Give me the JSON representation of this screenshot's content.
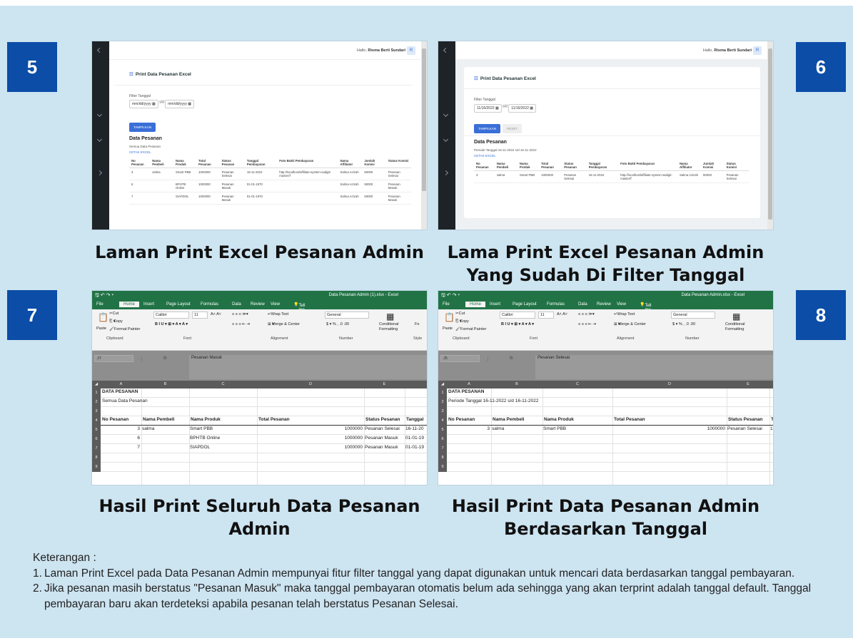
{
  "badges": [
    "5",
    "6",
    "7",
    "8"
  ],
  "captions": {
    "c5": "Laman Print Excel Pesanan Admin",
    "c6a": "Lama Print Excel Pesanan Admin",
    "c6b": "Yang Sudah Di Filter Tanggal",
    "c7a": "Hasil Print Seluruh Data Pesanan",
    "c7b": "Admin",
    "c8a": "Hasil Print Data Pesanan Admin",
    "c8b": "Berdasarkan Tanggal"
  },
  "notes": {
    "title": "Keterangan :",
    "items": [
      {
        "num": "1.",
        "text": "Laman Print Excel pada Data Pesanan Admin mempunyai fitur filter tanggal yang dapat digunakan untuk mencari data berdasarkan tanggal pembayaran."
      },
      {
        "num": "2.",
        "text": "Jika pesanan masih berstatus \"Pesanan Masuk\" maka tanggal pembayaran otomatis belum ada sehingga yang akan terprint adalah tanggal default. Tanggal pembayaran baru akan terdeteksi apabila pesanan telah berstatus Pesanan Selesai."
      }
    ]
  },
  "app": {
    "hello_prefix": "Hallo, ",
    "user": "Risma Berti Sundari",
    "avatar": "R",
    "title": "Print Data Pesanan Excel",
    "title_icon": "table-icon",
    "filter_label": "Filter Tanggal",
    "sd": "s/d",
    "btn_show": "TAMPILKAN",
    "btn_reset": "RESET",
    "data_title": "Data Pesanan",
    "export": "CETAK EXCEL",
    "headers": [
      "No Pesanan",
      "Nama Pembeli",
      "Nama Produk",
      "Total Pesanan",
      "Status Pesanan",
      "Tanggal Pembayaran",
      "Foto Bukti Pembayaran",
      "Nama Affiliator",
      "Jumlah Komisi",
      "Status Komisi"
    ]
  },
  "screen5": {
    "date_from": "mm/dd/yyyy",
    "date_to": "mm/dd/yyyy",
    "subtitle": "Semua Data Pesanan",
    "rows": [
      [
        "3",
        "salma",
        "Smart PBB",
        "1000000",
        "Pesanan Selesai",
        "16-11-2022",
        "http://localhost/affiliate-system-sadigit-master/f",
        "Salma Azizah",
        "50000",
        "Pesanan Selesai"
      ],
      [
        "6",
        "",
        "BPHTB Online",
        "1000000",
        "Pesanan Masuk",
        "01-01-1970",
        "",
        "Salma Azizah",
        "50000",
        "Pesanan Masuk"
      ],
      [
        "7",
        "",
        "SIAPDOL",
        "1000000",
        "Pesanan Masuk",
        "01-01-1970",
        "",
        "Salma Azizah",
        "50000",
        "Pesanan Masuk"
      ]
    ]
  },
  "screen6": {
    "date_from": "11/16/2022",
    "date_to": "11/16/2022",
    "subtitle": "Periode Tanggal 16-11-2022 s/d 16-11-2022",
    "rows": [
      [
        "3",
        "salma",
        "Smart PBB",
        "1000000",
        "Pesanan Selesai",
        "16-11-2022",
        "http://localhost/affiliate-system-sadigit-master/f",
        "Salma Azizah",
        "50000",
        "Pesanan Selesai"
      ]
    ]
  },
  "excel": {
    "menu": [
      "File",
      "Home",
      "Insert",
      "Page Layout",
      "Formulas",
      "Data",
      "Review",
      "View"
    ],
    "tell_me": "Tell me what you want to do...",
    "clipboard": {
      "cut": "Cut",
      "copy": "Copy",
      "paste": "Paste",
      "painter": "Format Painter",
      "label": "Clipboard"
    },
    "font": {
      "name": "Calibri",
      "size": "11",
      "label": "Font"
    },
    "alignment": {
      "wrap": "Wrap Text",
      "merge": "Merge & Center",
      "label": "Alignment"
    },
    "number": {
      "format": "General",
      "label": "Number"
    },
    "styles": {
      "conditional": "Conditional Formatting"
    },
    "fx": "fx",
    "cols": [
      "A",
      "B",
      "C",
      "D",
      "E"
    ],
    "rownums": [
      "1",
      "2",
      "3",
      "4",
      "5",
      "6",
      "7",
      "8",
      "9"
    ],
    "headers": [
      "No Pesanan",
      "Nama Pembeli",
      "Nama Produk",
      "Total Pesanan",
      "Status Pesanan"
    ]
  },
  "excel7": {
    "title": "Data Pesanan Admin (1).xlsx - Excel",
    "cell": "J7",
    "formula": "Pesanan Masuk",
    "a1": "DATA PESANAN",
    "a2": "Semua Data Pesanan",
    "f_header": "Tanggal",
    "styles_label": "Style",
    "table_label": "Fo",
    "rows": [
      {
        "a": "3",
        "b": "salma",
        "c": "Smart PBB",
        "d": "1000000",
        "e": "Pesanan Selesai",
        "f": "16-11-20"
      },
      {
        "a": "6",
        "b": "",
        "c": "BPHTB Online",
        "d": "1000000",
        "e": "Pesanan Masuk",
        "f": "01-01-19"
      },
      {
        "a": "7",
        "b": "",
        "c": "SIAPDOL",
        "d": "1000000",
        "e": "Pesanan Masuk",
        "f": "01-01-19"
      }
    ]
  },
  "excel8": {
    "title": "Data Pesanan Admin.xlsx - Excel",
    "cell": "J5",
    "formula": "Pesanan Selesai",
    "a1": "DATA PESANAN",
    "a2": "Periode Tanggal 16-11-2022 s/d 16-11-2022",
    "f_header": "T",
    "rows": [
      {
        "a": "3",
        "b": "salma",
        "c": "Smart PBB",
        "d": "1000000",
        "e": "Pesanan Selesai",
        "f": "1"
      }
    ]
  }
}
